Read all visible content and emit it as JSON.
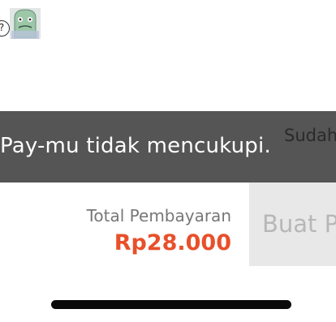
{
  "header": {
    "help_icon": "question-circle-icon",
    "help_glyph": "?",
    "mascot_icon": "mascot-avatar-icon"
  },
  "toast": {
    "message": "Pay-mu tidak mencukupi.",
    "secondary_text": "Sudah",
    "background": "#555555"
  },
  "checkout": {
    "total_label": "Total Pembayaran",
    "total_amount": "Rp28.000",
    "amount_color": "#e8502a",
    "place_order_label": "Buat P"
  }
}
